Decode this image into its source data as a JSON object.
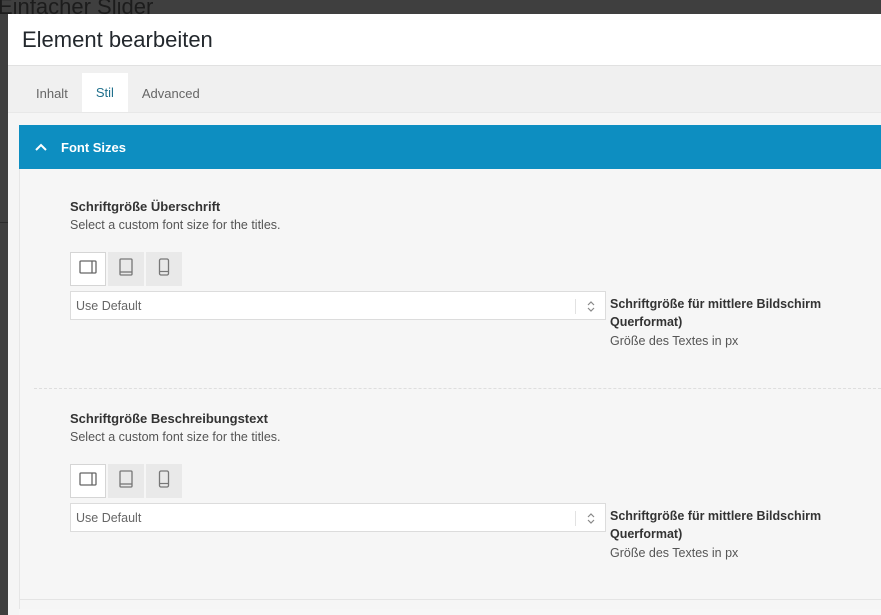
{
  "background": {
    "title": "Einfacher Slider"
  },
  "modal": {
    "title": "Element bearbeiten",
    "tabs": [
      {
        "label": "Inhalt",
        "active": false
      },
      {
        "label": "Stil",
        "active": true
      },
      {
        "label": "Advanced",
        "active": false
      }
    ]
  },
  "section": {
    "title": "Font Sizes",
    "expanded": true,
    "accent": "#0d8ec1"
  },
  "options": [
    {
      "label": "Schriftgröße Überschrift",
      "description": "Select a custom font size for the titles.",
      "devices": [
        "desktop-icon",
        "tablet-icon",
        "mobile-icon"
      ],
      "selected": "Use Default",
      "side_label": "Schriftgröße für mittlere Bildschirm",
      "side_label2": "Querformat)",
      "side_desc": "Größe des Textes in px"
    },
    {
      "label": "Schriftgröße Beschreibungstext",
      "description": "Select a custom font size for the titles.",
      "devices": [
        "desktop-icon",
        "tablet-icon",
        "mobile-icon"
      ],
      "selected": "Use Default",
      "side_label": "Schriftgröße für mittlere Bildschirm",
      "side_label2": "Querformat)",
      "side_desc": "Größe des Textes in px"
    }
  ]
}
